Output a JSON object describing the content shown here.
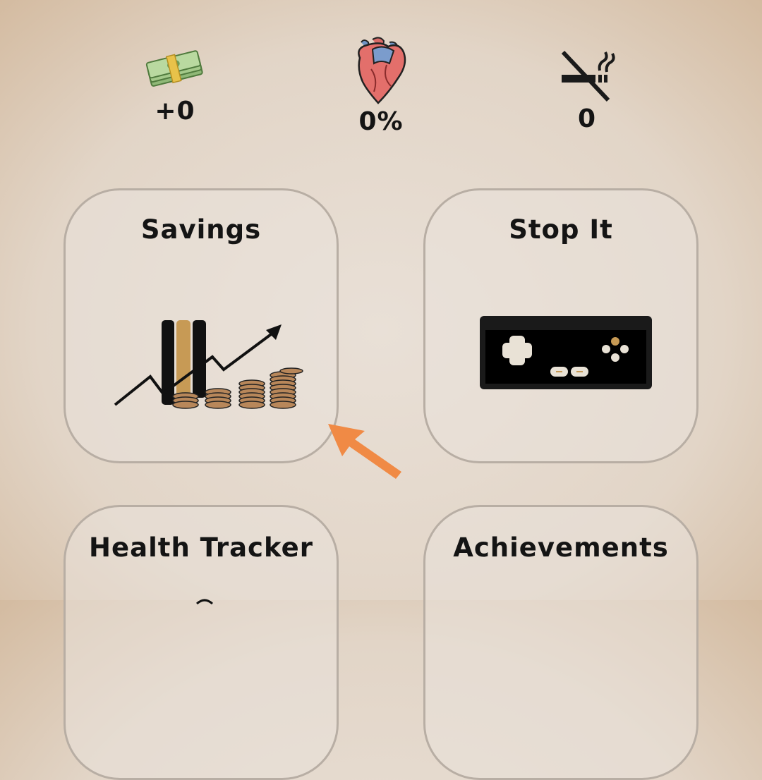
{
  "stats": [
    {
      "name": "money",
      "value": "+0"
    },
    {
      "name": "health",
      "value": "0%"
    },
    {
      "name": "cigarettes",
      "value": "0"
    }
  ],
  "cards": {
    "savings": {
      "title": "Savings"
    },
    "stop_it": {
      "title": "Stop It"
    },
    "health_tracker": {
      "title": "Health Tracker"
    },
    "achievements": {
      "title": "Achievements"
    }
  },
  "colors": {
    "accent_arrow": "#f08a45",
    "card_border": "#b8aea4",
    "text": "#141414"
  }
}
